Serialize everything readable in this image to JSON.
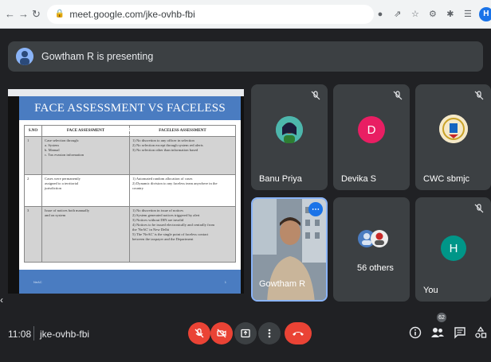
{
  "browser": {
    "url": "meet.google.com/jke-ovhb-fbi",
    "profile_initial": "H"
  },
  "presenting": {
    "text": "Gowtham R is presenting"
  },
  "slide": {
    "title": "FACE ASSESSMENT VS FACELESS ASSESSMENT",
    "headers": [
      "S.NO",
      "FACE ASSESSMENT",
      "FACELESS ASSESSMENT"
    ],
    "rows": [
      {
        "no": "1",
        "face": [
          "Case selection through:",
          "a. System",
          "b. Manual",
          "c. Tax evasion information"
        ],
        "faceless": [
          "1) No discretion to any officer in selection",
          "2) No selection except through system red alerts",
          "3) No selection other than information based"
        ]
      },
      {
        "no": "2",
        "face": [
          "Cases were permanently",
          "assigned to a territorial",
          "jurisdiction"
        ],
        "faceless": [
          "1) Automated random allocation of cases",
          "2) Dynamic division to any faceless team anywhere in the",
          "country"
        ]
      },
      {
        "no": "3",
        "face": [
          "Issue of notices both manually",
          "and on system"
        ],
        "faceless": [
          "1) No discretion in issue of notices",
          "2) System generated notices triggered by alert",
          "3) Notices without DIN are invalid",
          "4) Notices to be issued electronically and centrally from",
          "the 'NeAC' in New Delhi",
          "5) The 'NeAC' is the single point of faceless contact",
          "between the taxpayer and the Department"
        ]
      }
    ],
    "footer_left": "NeAC",
    "footer_right": "1"
  },
  "participants": [
    {
      "name": "Banu Priya",
      "avatar_color": "#4db6ac"
    },
    {
      "name": "Devika S",
      "initial": "D",
      "avatar_color": "#e91e63"
    },
    {
      "name": "CWC sbmjc",
      "avatar_color": "#f5e9c8"
    },
    {
      "name": "Gowtham R"
    },
    {
      "name": "56 others"
    },
    {
      "name": "You",
      "initial": "H",
      "avatar_color": "#009688"
    }
  ],
  "bottom": {
    "time": "11:08",
    "meeting_code": "jke-ovhb-fbi",
    "people_count": "62"
  },
  "edge_glyph": "‹"
}
